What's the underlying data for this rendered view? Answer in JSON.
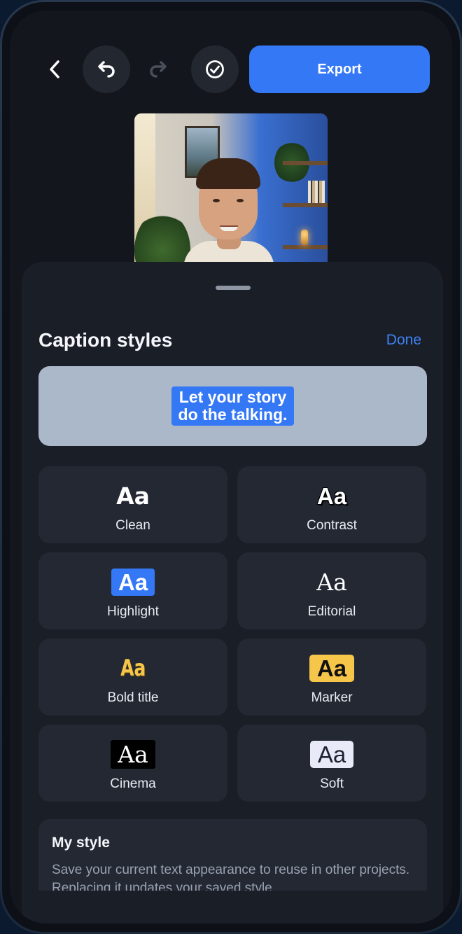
{
  "toolbar": {
    "back_icon": "chevron-left-icon",
    "undo_icon": "undo-icon",
    "redo_icon": "redo-icon",
    "check_icon": "check-circle-icon",
    "export_label": "Export",
    "accent_color": "#3478f6"
  },
  "sheet": {
    "title": "Caption styles",
    "done_label": "Done",
    "preview_caption_line1": "Let your story",
    "preview_caption_line2": "do the talking.",
    "styles": [
      {
        "glyph": "Aa",
        "label": "Clean"
      },
      {
        "glyph": "Aa",
        "label": "Contrast"
      },
      {
        "glyph": "Aa",
        "label": "Highlight"
      },
      {
        "glyph": "Aa",
        "label": "Editorial"
      },
      {
        "glyph": "Aa",
        "label": "Bold title"
      },
      {
        "glyph": "Aa",
        "label": "Marker"
      },
      {
        "glyph": "Aa",
        "label": "Cinema"
      },
      {
        "glyph": "Aa",
        "label": "Soft"
      }
    ],
    "my_style": {
      "title": "My style",
      "description": "Save your current text appearance to reuse in other projects. Replacing it updates your saved style."
    }
  }
}
